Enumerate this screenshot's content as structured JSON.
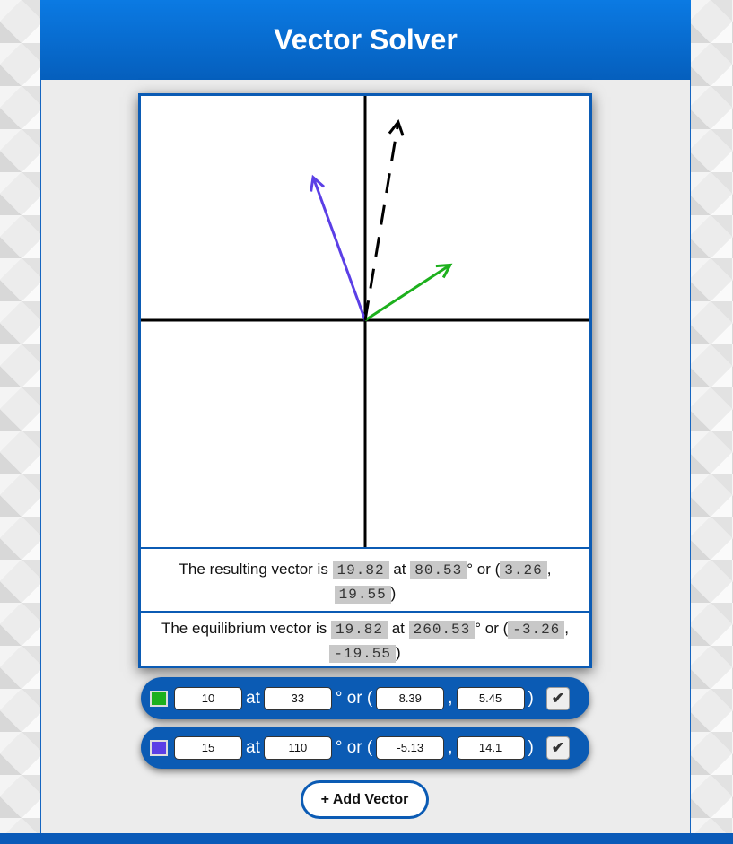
{
  "header": {
    "title": "Vector Solver"
  },
  "chart_data": {
    "type": "vector-diagram",
    "vectors": [
      {
        "magnitude": 10,
        "angle": 33,
        "x": 8.39,
        "y": 5.45,
        "color": "#1db01d"
      },
      {
        "magnitude": 15,
        "angle": 110,
        "x": -5.13,
        "y": 14.1,
        "color": "#5b3fe6"
      }
    ],
    "resultant": {
      "magnitude": 19.82,
      "angle": 80.53,
      "x": 3.26,
      "y": 19.55,
      "style": "dashed",
      "color": "#000000"
    }
  },
  "result": {
    "prefix": "The resulting vector is",
    "magnitude": "19.82",
    "at": "at",
    "angle": "80.53",
    "deg_or": "° or (",
    "x": "3.26",
    "comma": ",",
    "y": "19.55",
    "close": ")"
  },
  "equilibrium": {
    "prefix": "The equilibrium vector is",
    "magnitude": "19.82",
    "at": "at",
    "angle": "260.53",
    "deg_or": "° or (",
    "x": "-3.26",
    "comma": ",",
    "y": "-19.55",
    "close": ")"
  },
  "vector_rows": [
    {
      "color": "#1db01d",
      "magnitude": "10",
      "angle": "33",
      "x": "8.39",
      "y": "5.45",
      "enabled": true
    },
    {
      "color": "#5b3fe6",
      "magnitude": "15",
      "angle": "110",
      "x": "-5.13",
      "y": "14.1",
      "enabled": true
    }
  ],
  "row_labels": {
    "at": "at",
    "deg_or": "° or (",
    "comma": ",",
    "close": ")",
    "check": "✔"
  },
  "add_button": {
    "label": "+ Add Vector"
  }
}
